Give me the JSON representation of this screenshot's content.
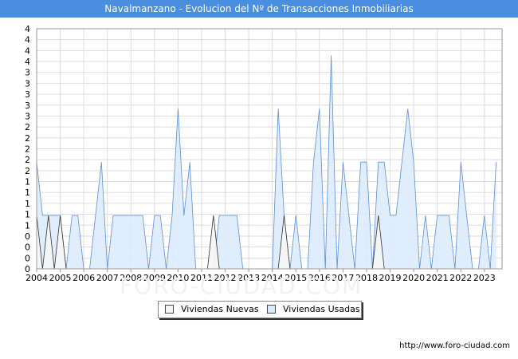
{
  "watermark": "FORO-CIUDAD.COM",
  "footer": "http://www.foro-ciudad.com",
  "chart_data": {
    "type": "area",
    "title": "Navalmanzano - Evolucion del Nº de Transacciones Inmobiliarias",
    "xlabel": "",
    "ylabel": "",
    "x_range": [
      2004,
      2023.75
    ],
    "ylim": [
      0,
      4.5
    ],
    "grid": true,
    "legend_position": "bottom-center",
    "x_ticks": [
      "2004",
      "2005",
      "2006",
      "2007",
      "2008",
      "2009",
      "2010",
      "2011",
      "2012",
      "2013",
      "2014",
      "2015",
      "2016",
      "2017",
      "2018",
      "2019",
      "2020",
      "2021",
      "2022",
      "2023"
    ],
    "y_ticks": [
      "0",
      "0",
      "0",
      "0",
      "1",
      "1",
      "1",
      "1",
      "1",
      "2",
      "2",
      "2",
      "2",
      "2",
      "3",
      "3",
      "3",
      "3",
      "3",
      "4",
      "4",
      "4",
      "4"
    ],
    "series": [
      {
        "name": "Viviendas Nuevas",
        "color": "#f5f5f5",
        "stroke": "#333333",
        "points": [
          [
            2004,
            1
          ],
          [
            2004.25,
            0
          ],
          [
            2004.5,
            1
          ],
          [
            2004.75,
            0
          ],
          [
            2005,
            1
          ],
          [
            2005.25,
            0
          ],
          [
            2011.25,
            0
          ],
          [
            2011.5,
            1
          ],
          [
            2011.75,
            0
          ],
          [
            2014.25,
            0
          ],
          [
            2014.5,
            1
          ],
          [
            2014.75,
            0
          ],
          [
            2018.25,
            0
          ],
          [
            2018.5,
            1
          ],
          [
            2018.75,
            0
          ]
        ]
      },
      {
        "name": "Viviendas Usadas",
        "color": "#dcebfc",
        "stroke": "#5b8fd6",
        "points": [
          [
            2004,
            2
          ],
          [
            2004.25,
            1
          ],
          [
            2004.5,
            1
          ],
          [
            2004.75,
            1
          ],
          [
            2005,
            1
          ],
          [
            2005.25,
            0
          ],
          [
            2005.5,
            1
          ],
          [
            2005.75,
            1
          ],
          [
            2006,
            0
          ],
          [
            2006.25,
            0
          ],
          [
            2006.5,
            1
          ],
          [
            2006.75,
            2
          ],
          [
            2007,
            0
          ],
          [
            2007.25,
            1
          ],
          [
            2007.5,
            1
          ],
          [
            2007.75,
            1
          ],
          [
            2008,
            1
          ],
          [
            2008.25,
            1
          ],
          [
            2008.5,
            1
          ],
          [
            2008.75,
            0
          ],
          [
            2009,
            1
          ],
          [
            2009.25,
            1
          ],
          [
            2009.5,
            0
          ],
          [
            2009.75,
            1
          ],
          [
            2010,
            3
          ],
          [
            2010.25,
            1
          ],
          [
            2010.5,
            2
          ],
          [
            2010.75,
            0
          ],
          [
            2011,
            0
          ],
          [
            2011.25,
            0
          ],
          [
            2011.5,
            0
          ],
          [
            2011.75,
            1
          ],
          [
            2012,
            1
          ],
          [
            2012.25,
            1
          ],
          [
            2012.5,
            1
          ],
          [
            2012.75,
            0
          ],
          [
            2013,
            0
          ],
          [
            2013.25,
            0
          ],
          [
            2013.5,
            0
          ],
          [
            2013.75,
            0
          ],
          [
            2014,
            0
          ],
          [
            2014.25,
            3
          ],
          [
            2014.5,
            1
          ],
          [
            2014.75,
            0
          ],
          [
            2015,
            1
          ],
          [
            2015.25,
            0
          ],
          [
            2015.5,
            0
          ],
          [
            2015.75,
            2
          ],
          [
            2016,
            3
          ],
          [
            2016.25,
            0
          ],
          [
            2016.5,
            4
          ],
          [
            2016.75,
            0
          ],
          [
            2017,
            2
          ],
          [
            2017.25,
            1
          ],
          [
            2017.5,
            0
          ],
          [
            2017.75,
            2
          ],
          [
            2018,
            2
          ],
          [
            2018.25,
            0
          ],
          [
            2018.5,
            2
          ],
          [
            2018.75,
            2
          ],
          [
            2019,
            1
          ],
          [
            2019.25,
            1
          ],
          [
            2019.5,
            2
          ],
          [
            2019.75,
            3
          ],
          [
            2020,
            2
          ],
          [
            2020.25,
            0
          ],
          [
            2020.5,
            1
          ],
          [
            2020.75,
            0
          ],
          [
            2021,
            1
          ],
          [
            2021.25,
            1
          ],
          [
            2021.5,
            1
          ],
          [
            2021.75,
            0
          ],
          [
            2022,
            2
          ],
          [
            2022.25,
            1
          ],
          [
            2022.5,
            0
          ],
          [
            2022.75,
            0
          ],
          [
            2023,
            1
          ],
          [
            2023.25,
            0
          ],
          [
            2023.5,
            2
          ]
        ]
      }
    ]
  }
}
